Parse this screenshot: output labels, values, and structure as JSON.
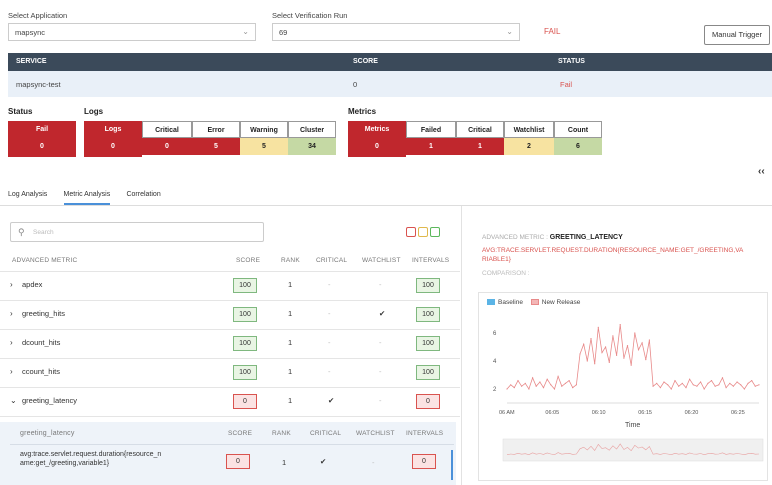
{
  "header": {
    "select_app_label": "Select Application",
    "select_app_value": "mapsync",
    "select_run_label": "Select Verification Run",
    "select_run_value": "69",
    "run_status": "FAIL",
    "manual_trigger_label": "Manual Trigger"
  },
  "service_table": {
    "columns": [
      "SERVICE",
      "SCORE",
      "STATUS"
    ],
    "row": {
      "service": "mapsync-test",
      "score": "0",
      "status": "Fail"
    }
  },
  "summary": {
    "status": {
      "title": "Status",
      "label": "Fail",
      "value": "0"
    },
    "logs": {
      "title": "Logs",
      "tiles": [
        {
          "label": "Logs",
          "value": "0"
        },
        {
          "label": "Critical",
          "value": "0"
        },
        {
          "label": "Error",
          "value": "5"
        },
        {
          "label": "Warning",
          "value": "5"
        },
        {
          "label": "Cluster",
          "value": "34"
        }
      ]
    },
    "metrics": {
      "title": "Metrics",
      "tiles": [
        {
          "label": "Metrics",
          "value": "0"
        },
        {
          "label": "Failed",
          "value": "1"
        },
        {
          "label": "Critical",
          "value": "1"
        },
        {
          "label": "Watchlist",
          "value": "2"
        },
        {
          "label": "Count",
          "value": "6"
        }
      ]
    },
    "collapse_glyph": "‹‹"
  },
  "tabs": [
    "Log Analysis",
    "Metric Analysis",
    "Correlation"
  ],
  "metric_table": {
    "search_placeholder": "Search",
    "columns": [
      "ADVANCED METRIC",
      "SCORE",
      "RANK",
      "CRITICAL",
      "WATCHLIST",
      "INTERVALS"
    ],
    "rows": [
      {
        "name": "apdex",
        "score": "100",
        "rank": "1",
        "critical": "-",
        "watchlist": "-",
        "intervals": "100"
      },
      {
        "name": "greeting_hits",
        "score": "100",
        "rank": "1",
        "critical": "-",
        "watchlist": "✔",
        "intervals": "100"
      },
      {
        "name": "dcount_hits",
        "score": "100",
        "rank": "1",
        "critical": "-",
        "watchlist": "-",
        "intervals": "100"
      },
      {
        "name": "ccount_hits",
        "score": "100",
        "rank": "1",
        "critical": "-",
        "watchlist": "-",
        "intervals": "100"
      },
      {
        "name": "greeting_latency",
        "score": "0",
        "rank": "1",
        "critical": "✔",
        "watchlist": "-",
        "intervals": "0"
      }
    ],
    "sub": {
      "columns": [
        "greeting_latency",
        "SCORE",
        "RANK",
        "CRITICAL",
        "WATCHLIST",
        "INTERVALS"
      ],
      "name_line1": "avg:trace.servlet.request.duration{resource_n",
      "name_line2": "ame:get_/greeting,variable1}",
      "score": "0",
      "rank": "1",
      "critical": "✔",
      "watchlist": "-",
      "intervals": "0"
    }
  },
  "detail": {
    "adv_metric_label": "ADVANCED METRIC :",
    "adv_metric_value": "GREETING_LATENCY",
    "query_line1": "AVG:TRACE.SERVLET.REQUEST.DURATION{RESOURCE_NAME:GET_/GREETING,VA",
    "query_line2": "RIABLE1}",
    "comparison_label": "COMPARISON :",
    "legend_baseline": "Baseline",
    "legend_new_release": "New Release",
    "colors": {
      "baseline": "#5bb4e6",
      "new_release": "#e88a8a",
      "fail": "#c0272d"
    }
  },
  "chart_data": {
    "type": "line",
    "xlabel": "Time",
    "x_ticks": [
      "06 AM",
      "06:05",
      "06:10",
      "06:15",
      "06:20",
      "06:25"
    ],
    "y_ticks": [
      2,
      4,
      6
    ],
    "ylim": [
      1,
      7
    ],
    "series": [
      {
        "name": "New Release",
        "values": [
          2,
          2.3,
          2.1,
          2.6,
          2.2,
          2.4,
          2.0,
          2.8,
          2.2,
          2.5,
          2.1,
          2.7,
          2.3,
          2.0,
          2.9,
          2.2,
          2.4,
          2.6,
          2.1,
          2.3,
          4.5,
          5.2,
          4.0,
          5.6,
          3.8,
          6.4,
          4.6,
          5.0,
          3.9,
          5.8,
          4.4,
          6.6,
          4.2,
          5.1,
          3.7,
          6.0,
          4.8,
          5.3,
          4.1,
          5.5,
          2.2,
          2.4,
          2.1,
          2.5,
          2.3,
          2.0,
          2.6,
          2.2,
          2.4,
          2.1,
          2.7,
          2.3,
          2.2,
          2.5,
          2.0,
          2.4,
          2.6,
          2.2,
          2.3,
          2.8,
          2.1,
          2.4,
          2.2,
          2.5,
          2.3,
          2.0,
          2.4,
          2.6,
          2.2,
          2.3
        ]
      }
    ],
    "legend": "top-left",
    "grid": false
  }
}
